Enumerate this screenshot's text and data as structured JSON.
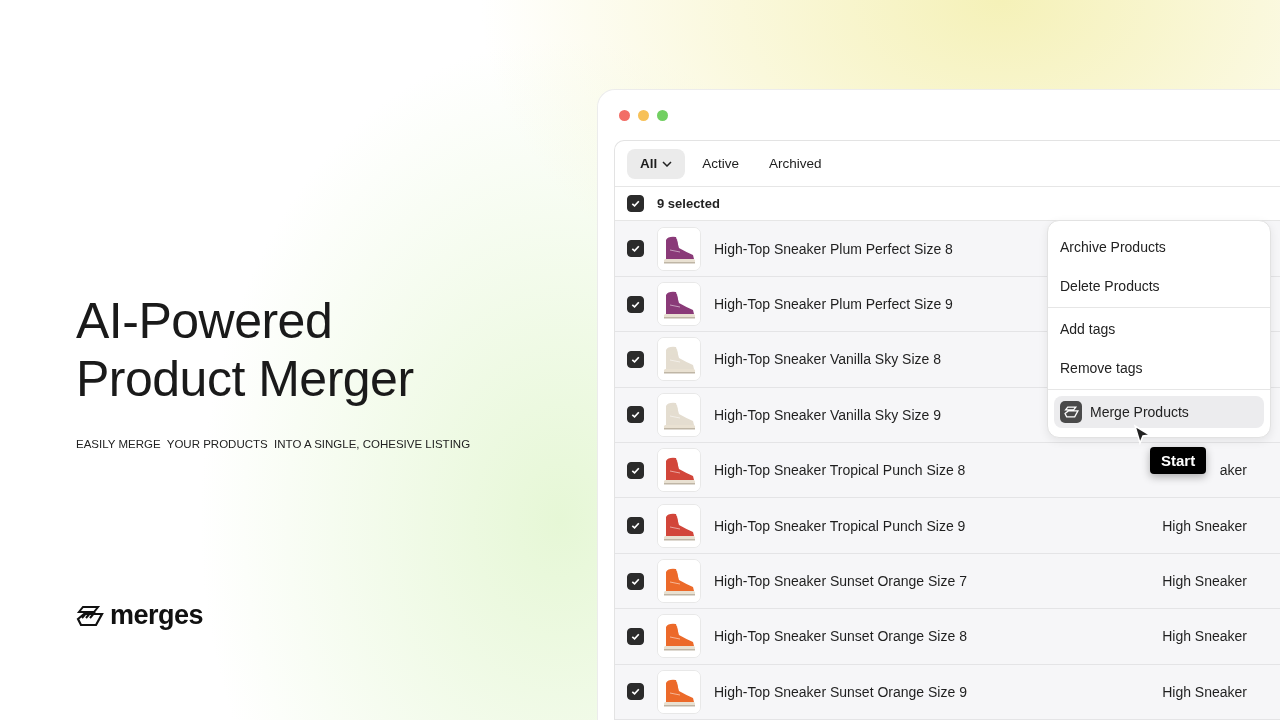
{
  "hero": {
    "title_lines": [
      "AI-Powered",
      "Product Merger"
    ],
    "subtitle": "EASILY MERGE  YOUR PRODUCTS  INTO A SINGLE, COHESIVE LISTING",
    "brand": "merges"
  },
  "tabs": [
    {
      "label": "All",
      "selected": true,
      "dropdown": true
    },
    {
      "label": "Active",
      "selected": false,
      "dropdown": false
    },
    {
      "label": "Archived",
      "selected": false,
      "dropdown": false
    }
  ],
  "selection": {
    "checked": true,
    "label": "9 selected"
  },
  "rows": [
    {
      "name": "High-Top Sneaker Plum Perfect Size 8",
      "checked": true,
      "color": "#8a3a78"
    },
    {
      "name": "High-Top Sneaker Plum Perfect Size 9",
      "checked": true,
      "color": "#8a3a78"
    },
    {
      "name": "High-Top Sneaker Vanilla Sky Size 8",
      "checked": true,
      "color": "#e4ddd0"
    },
    {
      "name": "High-Top Sneaker Vanilla Sky Size 9",
      "checked": true,
      "color": "#e4ddd0"
    },
    {
      "name": "High-Top Sneaker Tropical Punch Size 8",
      "checked": true,
      "color": "#d2463a",
      "type": "aker"
    },
    {
      "name": "High-Top Sneaker Tropical Punch Size 9",
      "checked": true,
      "color": "#d2463a",
      "type": "High Sneaker"
    },
    {
      "name": "High-Top Sneaker Sunset Orange Size 7",
      "checked": true,
      "color": "#ec6a2a",
      "type": "High Sneaker"
    },
    {
      "name": "High-Top Sneaker Sunset Orange Size 8",
      "checked": true,
      "color": "#ec6a2a",
      "type": "High Sneaker"
    },
    {
      "name": "High-Top Sneaker Sunset Orange Size 9",
      "checked": true,
      "color": "#ec6a2a",
      "type": "High Sneaker"
    }
  ],
  "menu": {
    "groups": [
      [
        {
          "label": "Archive Products",
          "highlighted": false,
          "icon": false
        },
        {
          "label": "Delete Products",
          "highlighted": false,
          "icon": false
        }
      ],
      [
        {
          "label": "Add tags",
          "highlighted": false,
          "icon": false
        },
        {
          "label": "Remove tags",
          "highlighted": false,
          "icon": false
        }
      ],
      [
        {
          "label": "Merge Products",
          "highlighted": true,
          "icon": true
        }
      ]
    ]
  },
  "tooltip": "Start"
}
